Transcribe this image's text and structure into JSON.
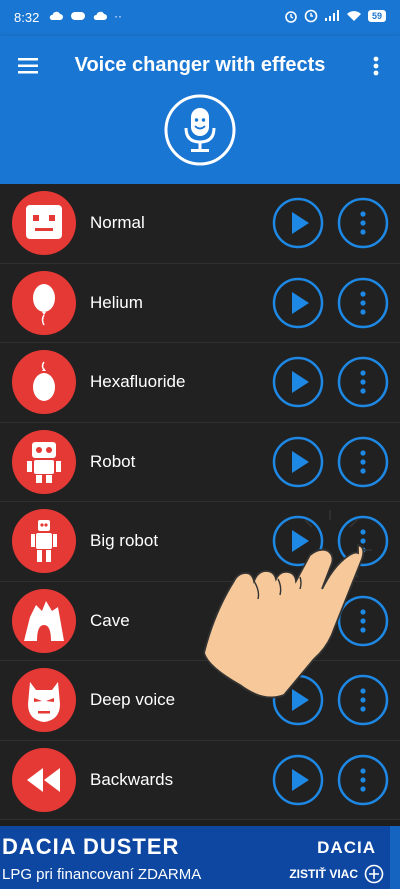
{
  "status": {
    "time": "8:32",
    "battery": "59"
  },
  "app": {
    "title": "Voice changer with effects"
  },
  "effects": [
    {
      "label": "Normal",
      "icon": "normal-face-icon"
    },
    {
      "label": "Helium",
      "icon": "balloon-icon"
    },
    {
      "label": "Hexafluoride",
      "icon": "heavy-balloon-icon"
    },
    {
      "label": "Robot",
      "icon": "robot-icon"
    },
    {
      "label": "Big robot",
      "icon": "big-robot-icon"
    },
    {
      "label": "Cave",
      "icon": "cave-icon"
    },
    {
      "label": "Deep voice",
      "icon": "deep-voice-mask-icon"
    },
    {
      "label": "Backwards",
      "icon": "rewind-icon"
    }
  ],
  "ad": {
    "title": "DACIA  DUSTER",
    "subtitle": "LPG pri financovaní ZDARMA",
    "brand": "DACIA",
    "cta": "ZISTIŤ VIAC"
  },
  "colors": {
    "primary": "#1976d2",
    "accent": "#1e88e5",
    "avatar": "#e53935",
    "background": "#212121"
  }
}
